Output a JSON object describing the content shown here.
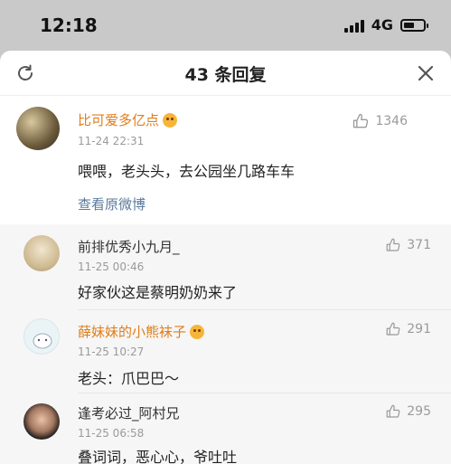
{
  "status": {
    "time": "12:18",
    "network": "4G"
  },
  "header": {
    "title": "43 条回复"
  },
  "root": {
    "username": "比可爱多亿点",
    "time": "11-24 22:31",
    "likes": "1346",
    "text": "喂喂，老头头，去公园坐几路车车",
    "view_original": "查看原微博"
  },
  "replies": [
    {
      "username": "前排优秀小九月_",
      "time": "11-25 00:46",
      "likes": "371",
      "text": "好家伙这是蔡明奶奶来了",
      "name_color": "#333333"
    },
    {
      "username": "薛妹妹的小熊袜子",
      "time": "11-25 10:27",
      "likes": "291",
      "text": "老头：爪巴巴～",
      "name_color": "#e07d1a"
    },
    {
      "username": "逢考必过_阿村兄",
      "time": "11-25 06:58",
      "likes": "295",
      "text": "叠词词，恶心心，爷吐吐",
      "name_color": "#333333"
    }
  ],
  "colors": {
    "accent_orange": "#e07d1a",
    "link_blue": "#5b7a9c",
    "meta_gray": "#9a9a9a"
  },
  "icons": {
    "refresh": "refresh-icon",
    "close": "close-icon",
    "like": "thumb-up-icon"
  }
}
